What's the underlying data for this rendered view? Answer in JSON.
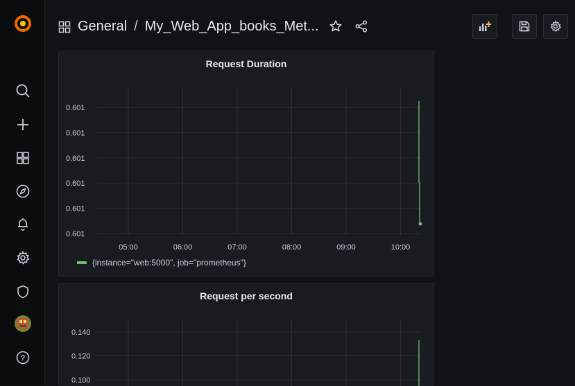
{
  "breadcrumb": {
    "folder": "General",
    "separator": "/",
    "dashboard_title": "My_Web_App_books_Met..."
  },
  "sidebar": {
    "items": [
      {
        "icon": "search-icon"
      },
      {
        "icon": "plus-icon"
      },
      {
        "icon": "dashboards-icon"
      },
      {
        "icon": "explore-compass-icon"
      },
      {
        "icon": "alerting-bell-icon"
      },
      {
        "icon": "configuration-gear-icon"
      },
      {
        "icon": "shield-icon"
      },
      {
        "icon": "avatar"
      },
      {
        "icon": "help-icon"
      }
    ]
  },
  "toolbar": {
    "add_panel_icon": "add-panel-icon",
    "save_icon": "save-icon",
    "settings_icon": "settings-gear-icon"
  },
  "colors": {
    "series": "#73bf69",
    "panel_bg": "#181b1f",
    "page_bg": "#111217",
    "logo": "#f46800"
  },
  "panels": [
    {
      "title": "Request Duration",
      "y_ticks": [
        "0.601",
        "0.601",
        "0.601",
        "0.601",
        "0.601",
        "0.601"
      ],
      "x_ticks": [
        "05:00",
        "06:00",
        "07:00",
        "08:00",
        "09:00",
        "10:00"
      ],
      "legend": "{instance=\"web:5000\", job=\"prometheus\"}"
    },
    {
      "title": "Request per second",
      "y_ticks": [
        "0.140",
        "0.120",
        "0.100"
      ]
    }
  ],
  "chart_data": [
    {
      "type": "line",
      "title": "Request Duration",
      "x_ticks": [
        "05:00",
        "06:00",
        "07:00",
        "08:00",
        "09:00",
        "10:00"
      ],
      "y_tick_labels": [
        "0.601",
        "0.601",
        "0.601",
        "0.601",
        "0.601",
        "0.601"
      ],
      "series": [
        {
          "name": "{instance=\"web:5000\", job=\"prometheus\"}",
          "color": "#73bf69"
        }
      ],
      "legend_position": "bottom-left",
      "grid": true
    },
    {
      "type": "line",
      "title": "Request per second",
      "y_tick_labels": [
        "0.140",
        "0.120",
        "0.100"
      ],
      "grid": true
    }
  ]
}
